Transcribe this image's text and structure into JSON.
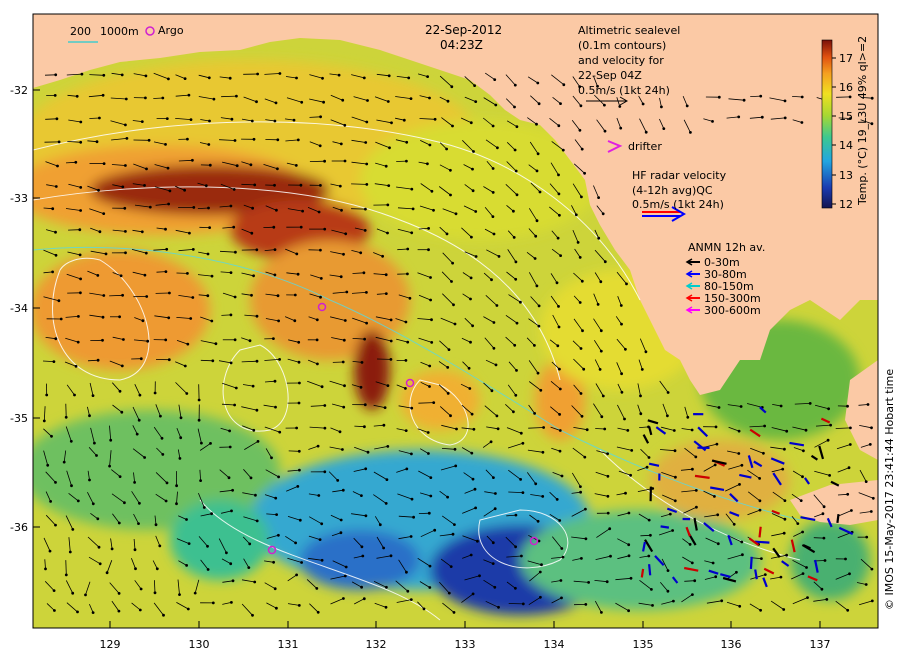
{
  "header": {
    "date": "22-Sep-2012",
    "time": "04:23Z"
  },
  "scale_bar": {
    "short": "200",
    "long": "1000m"
  },
  "argo_label": "Argo",
  "altimetry_note": {
    "line1": "Altimetric sealevel",
    "line2": "(0.1m contours)",
    "line3": "and velocity for",
    "line4": "22-Sep 04Z",
    "line5": "0.5m/s (1kt 24h)"
  },
  "drifter_label": "drifter",
  "hf_radar": {
    "line1": "HF radar velocity",
    "line2": "(4-12h avg)QC",
    "line3": "0.5m/s (1kt 24h)"
  },
  "anmn": {
    "title": "ANMN 12h av.",
    "items": [
      {
        "label": "0-30m",
        "color": "#000000"
      },
      {
        "label": "30-80m",
        "color": "#0000ff"
      },
      {
        "label": "80-150m",
        "color": "#00cccc"
      },
      {
        "label": "150-300m",
        "color": "#ff0000"
      },
      {
        "label": "300-600m",
        "color": "#ff00ff"
      }
    ]
  },
  "colorbar": {
    "label": "Temp. (°C) 19_L3U 49% ql>=2",
    "ticks": [
      "17",
      "16",
      "15",
      "14",
      "13",
      "12"
    ],
    "range": [
      12,
      17.5
    ]
  },
  "axes": {
    "lat_ticks": [
      "-32",
      "-33",
      "-34",
      "-35",
      "-36"
    ],
    "lon_ticks": [
      "129",
      "130",
      "131",
      "132",
      "133",
      "134",
      "135",
      "136",
      "137"
    ]
  },
  "credit": "© IMOS 15-May-2017 23:41:44 Hobart time",
  "colors": {
    "land": "#fbc9a5",
    "hot": "#8b1a0a",
    "warm": "#f0a030",
    "mid": "#d8dc30",
    "cool": "#2fa8d8",
    "cold": "#1a2a9a"
  }
}
